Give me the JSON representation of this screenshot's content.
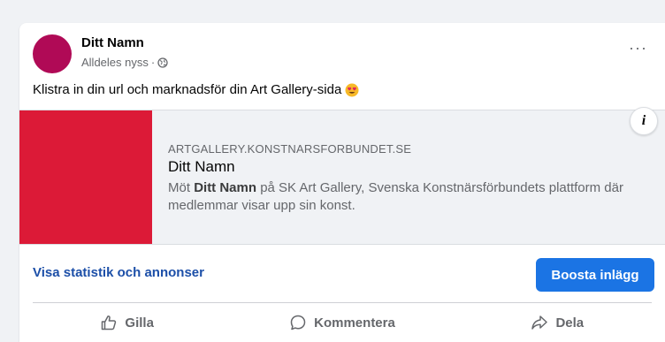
{
  "post": {
    "author": "Ditt Namn",
    "timestamp": "Alldeles nyss",
    "separator": "·",
    "privacy_icon": "globe-icon",
    "more_label": "···",
    "text": "Klistra in din url och marknadsför din Art Gallery-sida",
    "emoji": "heart-eyes-emoji"
  },
  "link_preview": {
    "thumbnail_color": "#dc1a37",
    "info_label": "i",
    "domain": "ARTGALLERY.KONSTNARSFORBUNDET.SE",
    "title": "Ditt Namn",
    "desc_prefix": "Möt ",
    "desc_name": "Ditt Namn",
    "desc_suffix": " på SK Art Gallery, Svenska Konstnärsförbundets plattform där medlemmar visar upp sin konst."
  },
  "promo": {
    "stats_link": "Visa statistik och annonser",
    "boost_button": "Boosta inlägg"
  },
  "actions": {
    "like": "Gilla",
    "comment": "Kommentera",
    "share": "Dela"
  },
  "colors": {
    "avatar": "#b00a56",
    "accent": "#1b74e4",
    "link": "#1c4fa8"
  }
}
